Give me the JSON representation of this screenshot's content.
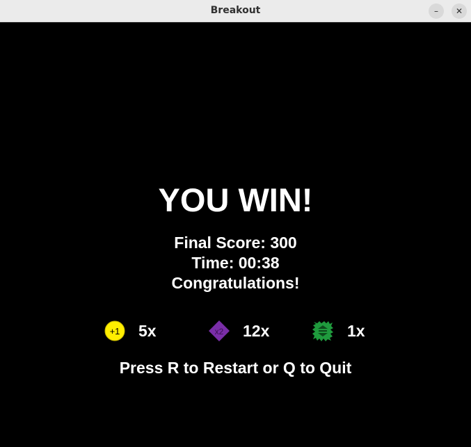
{
  "window": {
    "title": "Breakout",
    "minimize_glyph": "–",
    "close_glyph": "✕"
  },
  "screen": {
    "headline": "YOU WIN!",
    "final_score": "Final Score: 300",
    "time": "Time: 00:38",
    "message": "Congratulations!",
    "prompt": "Press R to Restart or Q to Quit"
  },
  "powerups": [
    {
      "icon": "plus-one-coin-icon",
      "label": "+1",
      "count": "5x",
      "color": "#ffee00"
    },
    {
      "icon": "times-two-diamond-icon",
      "label": "x2",
      "count": "12x",
      "color": "#7a2ea8"
    },
    {
      "icon": "expand-paddle-star-icon",
      "label": "",
      "count": "1x",
      "color": "#1f9a3d"
    }
  ]
}
